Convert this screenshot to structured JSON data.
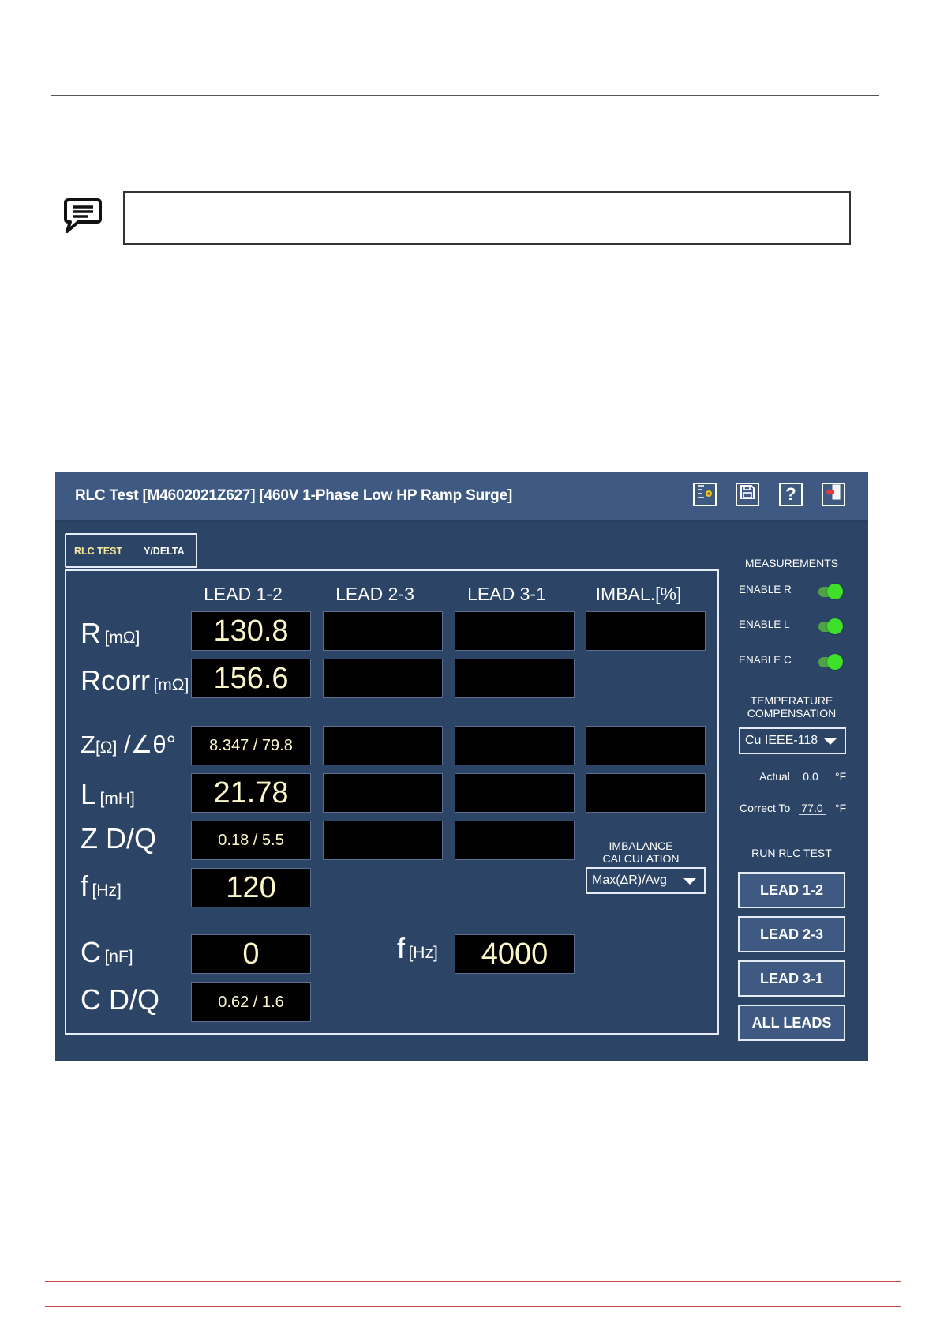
{
  "app": {
    "title": "RLC Test  [M4602021Z627] [460V 1-Phase Low HP Ramp Surge]",
    "toolbar": {
      "help_label": "?"
    },
    "tabs": [
      {
        "label": "RLC TEST",
        "active": true
      },
      {
        "label": "Y/DELTA",
        "active": false
      }
    ],
    "columns": [
      "LEAD 1-2",
      "LEAD 2-3",
      "LEAD 3-1",
      "IMBAL.[%]"
    ],
    "rows": {
      "r": {
        "label": "R",
        "unit": "[mΩ]",
        "values": [
          "130.8",
          "",
          "",
          ""
        ]
      },
      "rcorr": {
        "label": "Rcorr",
        "unit": "[mΩ]",
        "values": [
          "156.6",
          "",
          ""
        ]
      },
      "z": {
        "label": "Z",
        "unit": "[Ω]",
        "suffix": " /∠θ°",
        "values": [
          "8.347 / 79.8",
          "",
          "",
          ""
        ]
      },
      "l": {
        "label": "L",
        "unit": "[mH]",
        "values": [
          "21.78",
          "",
          "",
          ""
        ]
      },
      "zdq": {
        "label": "Z D/Q",
        "values": [
          "0.18 / 5.5",
          "",
          ""
        ]
      },
      "f": {
        "label": "f",
        "unit": "[Hz]",
        "value": "120"
      },
      "c": {
        "label": "C",
        "unit": "[nF]",
        "value": "0"
      },
      "cf": {
        "label": "f",
        "unit": "[Hz]",
        "value": "4000"
      },
      "cdq": {
        "label": "C D/Q",
        "value": "0.62 / 1.6"
      }
    },
    "imbalance": {
      "label_line1": "IMBALANCE",
      "label_line2": "CALCULATION",
      "selected": "Max(ΔR)/Avg"
    },
    "measurements": {
      "heading": "MEASUREMENTS",
      "enable_r": {
        "label": "ENABLE R",
        "on": true
      },
      "enable_l": {
        "label": "ENABLE L",
        "on": true
      },
      "enable_c": {
        "label": "ENABLE C",
        "on": true
      }
    },
    "temperature": {
      "heading_line1": "TEMPERATURE",
      "heading_line2": "COMPENSATION",
      "selected": "Cu IEEE-118",
      "actual_label": "Actual",
      "actual_value": "0.0",
      "correct_label": "Correct To",
      "correct_value": "77.0",
      "unit": "°F"
    },
    "run": {
      "heading": "RUN RLC TEST",
      "buttons": [
        "LEAD 1-2",
        "LEAD 2-3",
        "LEAD 3-1",
        "ALL LEADS"
      ]
    },
    "colors": {
      "background": "#2c4466",
      "titlebar": "#3e5a82",
      "value_text": "#fbf6c8",
      "toggle_on": "#3fe02a"
    }
  }
}
